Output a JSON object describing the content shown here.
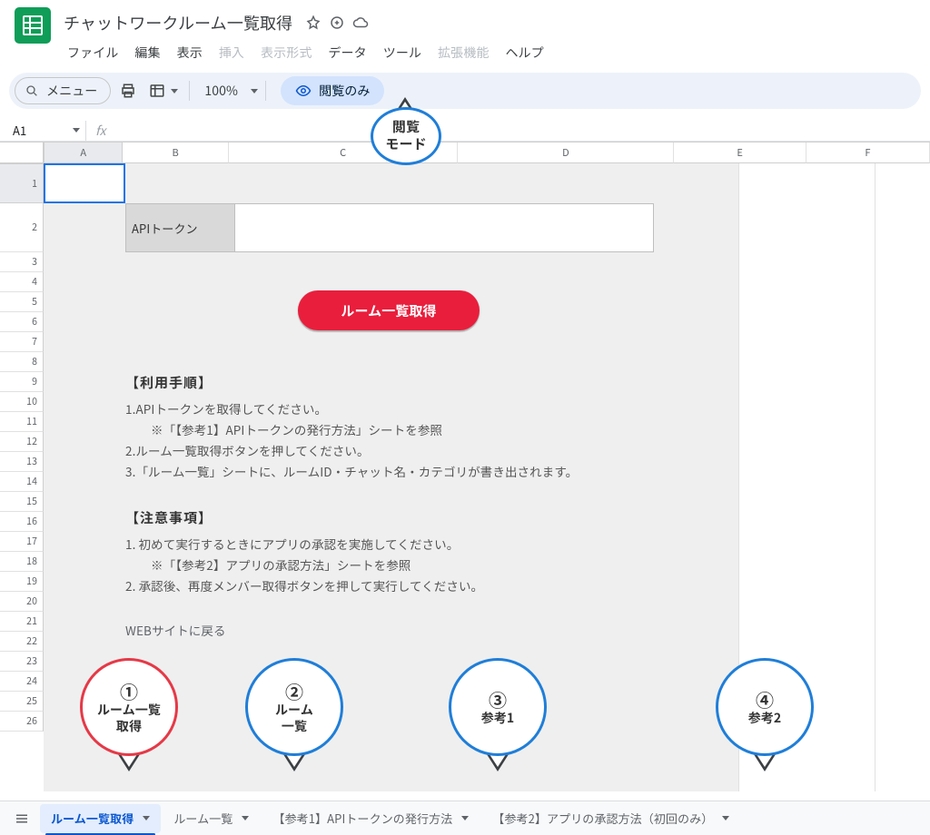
{
  "header": {
    "title": "チャットワークルーム一覧取得"
  },
  "menus": [
    "ファイル",
    "編集",
    "表示",
    "挿入",
    "表示形式",
    "データ",
    "ツール",
    "拡張機能",
    "ヘルプ"
  ],
  "menus_disabled": [
    3,
    4,
    7
  ],
  "toolbar": {
    "menu_label": "メニュー",
    "zoom": "100%",
    "view_chip": "閲覧のみ"
  },
  "namebox": "A1",
  "columns": [
    "A",
    "B",
    "C",
    "D",
    "E",
    "F"
  ],
  "rows": 26,
  "content": {
    "api_label": "APIトークン",
    "button": "ルーム一覧取得",
    "h1": "【利用手順】",
    "l1": "1.APIトークンを取得してください。",
    "l1a": "※「【参考1】APIトークンの発行方法」シートを参照",
    "l2": "2.ルーム一覧取得ボタンを押してください。",
    "l3": "3.「ルーム一覧」シートに、ルームID・チャット名・カテゴリが書き出されます。",
    "h2": "【注意事項】",
    "n1": "1. 初めて実行するときにアプリの承認を実施してください。",
    "n1a": "※「【参考2】アプリの承認方法」シートを参照",
    "n2": "2. 承認後、再度メンバー取得ボタンを押して実行してください。",
    "web": "WEBサイトに戻る"
  },
  "sheet_tabs": [
    "ルーム一覧取得",
    "ルーム一覧",
    "【参考1】APIトークンの発行方法",
    "【参考2】アプリの承認方法（初回のみ）"
  ],
  "annotations": {
    "top": {
      "l1": "閲覧",
      "l2": "モード"
    },
    "b1": {
      "num": "①",
      "l1": "ルーム一覧",
      "l2": "取得"
    },
    "b2": {
      "num": "②",
      "l1": "ルーム",
      "l2": "一覧"
    },
    "b3": {
      "num": "③",
      "l1": "参考1"
    },
    "b4": {
      "num": "④",
      "l1": "参考2"
    }
  }
}
